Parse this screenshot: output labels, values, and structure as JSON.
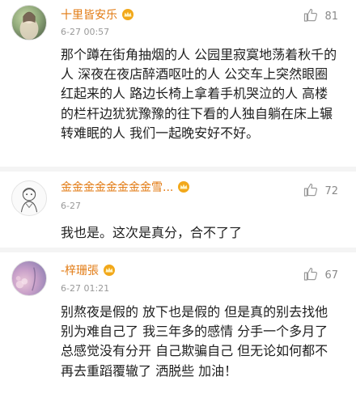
{
  "comments": [
    {
      "username": "十里皆安乐",
      "time": "6-27 00:57",
      "likes": "81",
      "text": "那个蹲在街角抽烟的人 公园里寂寞地荡着秋千的人 深夜在夜店醉酒呕吐的人 公交车上突然眼圈红起来的人 路边长椅上拿着手机哭泣的人 高楼的栏杆边犹犹豫豫的往下看的人独自躺在床上辗转难眠的人 我们一起晚安好不好。",
      "badge_icon": "crown-icon"
    },
    {
      "username": "金金金金金金金金雪...",
      "time": "6-27",
      "likes": "72",
      "text": "我也是。这次是真分，合不了了",
      "badge_icon": "crown-icon"
    },
    {
      "username": "-梓珊張",
      "time": "6-27 01:21",
      "likes": "67",
      "text": "别熬夜是假的 放下也是假的 但是真的别去找他 别为难自己了 我三年多的感情 分手一个多月了 总感觉没有分开 自己欺骗自己 但无论如何都不再去重蹈覆辙了 洒脱些 加油！",
      "badge_icon": "crown-icon"
    }
  ],
  "colors": {
    "username": "#e27a12",
    "crown": "#f2a81a",
    "meta": "#999999",
    "text": "#1e1e1e"
  },
  "icons": {
    "like": "thumbs-up-icon"
  }
}
